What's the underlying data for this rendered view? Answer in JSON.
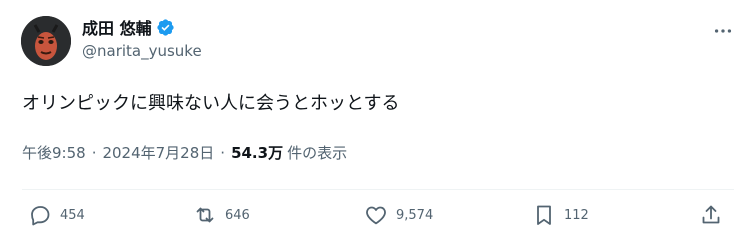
{
  "author": {
    "display_name": "成田 悠輔",
    "handle": "@narita_yusuke",
    "verified": true,
    "verified_color": "#1d9bf0"
  },
  "tweet": {
    "text": "オリンピックに興味ない人に会うとホッとする",
    "time": "午後9:58",
    "separator": "·",
    "date": "2024年7月28日",
    "views_count": "54.3万",
    "views_label": "件の表示"
  },
  "actions": {
    "reply": {
      "icon": "reply-icon",
      "count": "454"
    },
    "retweet": {
      "icon": "retweet-icon",
      "count": "646"
    },
    "like": {
      "icon": "heart-icon",
      "count": "9,574"
    },
    "bookmark": {
      "icon": "bookmark-icon",
      "count": "112"
    },
    "share": {
      "icon": "share-icon"
    }
  },
  "colors": {
    "text_primary": "#0f1419",
    "text_secondary": "#536471",
    "divider": "#eff3f4",
    "icon": "#536471"
  }
}
